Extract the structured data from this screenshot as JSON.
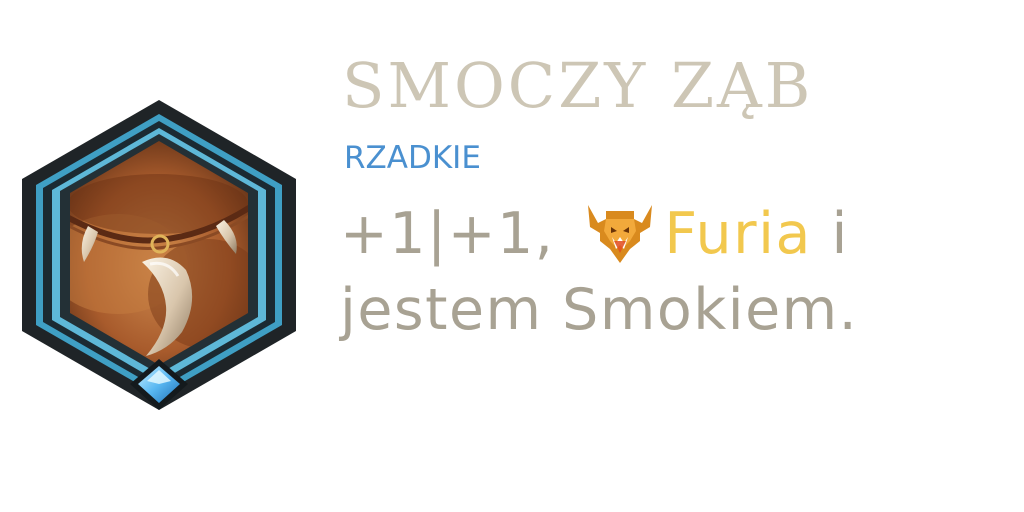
{
  "item": {
    "icon": "dragon-tooth-necklace-icon",
    "title": "SMOCZY ZĄB",
    "rarity": "RZADKIE",
    "description": {
      "stats": "+1|+1,",
      "keyword_icon": "fury-keyword-icon",
      "keyword": "Furia",
      "conjunction": "i",
      "line2": "jestem Smokiem."
    }
  },
  "colors": {
    "title": "#cdc6b5",
    "rarity": "#4a90d0",
    "text": "#a8a293",
    "keyword": "#f2c84e",
    "frame_teal": "#3f9fc4",
    "frame_dark": "#20272a",
    "gem": "#59b8f2"
  }
}
